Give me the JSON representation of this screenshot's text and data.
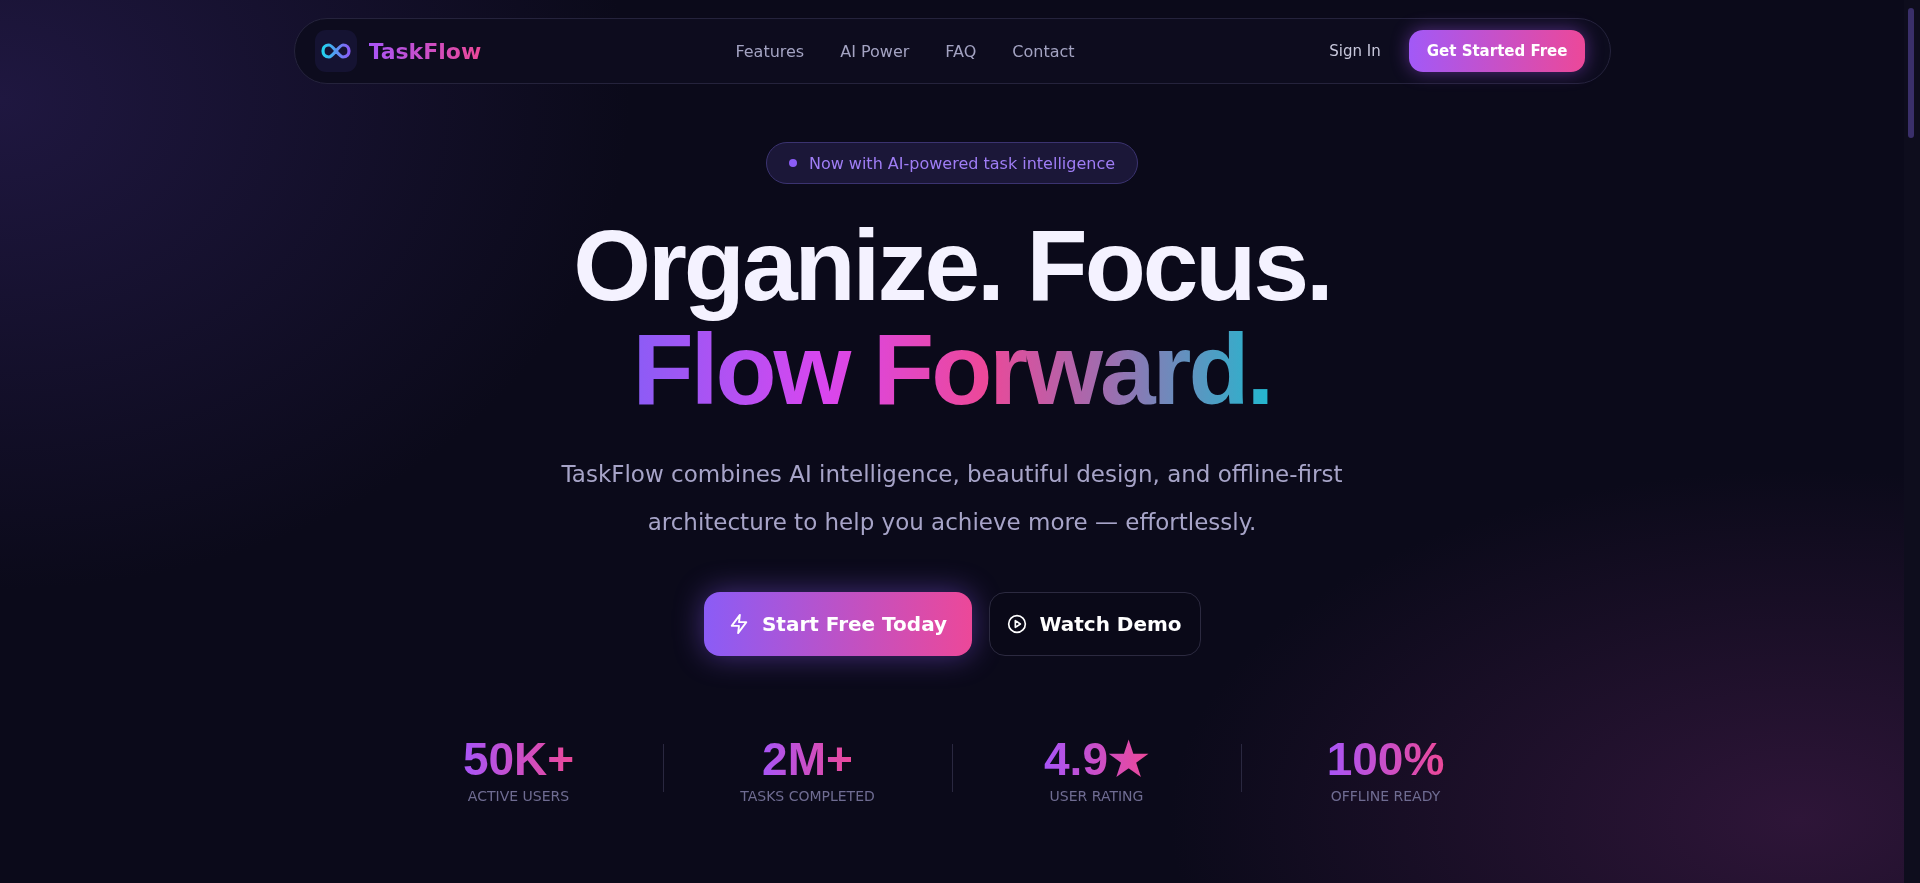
{
  "nav": {
    "brand": "TaskFlow",
    "links": [
      "Features",
      "AI Power",
      "FAQ",
      "Contact"
    ],
    "sign_in": "Sign In",
    "cta": "Get Started Free"
  },
  "hero": {
    "badge": "Now with AI-powered task intelligence",
    "headline_line1": "Organize. Focus.",
    "headline_line2": "Flow Forward.",
    "subtitle": "TaskFlow combines AI intelligence, beautiful design, and offline-first architecture to help you achieve more — effortlessly.",
    "primary_button": "Start Free Today",
    "secondary_button": "Watch Demo"
  },
  "stats": [
    {
      "value": "50K+",
      "label": "ACTIVE USERS"
    },
    {
      "value": "2M+",
      "label": "TASKS COMPLETED"
    },
    {
      "value": "4.9★",
      "label": "USER RATING"
    },
    {
      "value": "100%",
      "label": "OFFLINE READY"
    }
  ]
}
